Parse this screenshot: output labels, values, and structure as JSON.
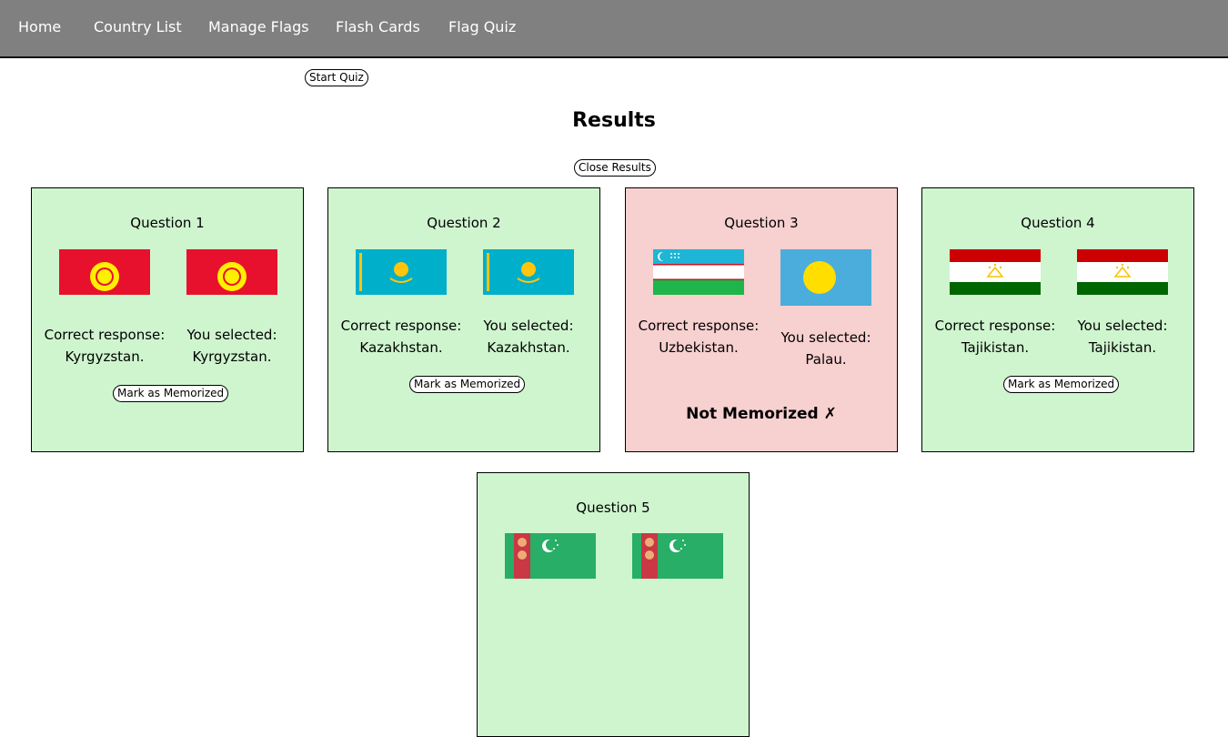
{
  "nav": {
    "items": [
      "Home",
      "Country List",
      "Manage Flags",
      "Flash Cards",
      "Flag Quiz"
    ]
  },
  "start_quiz_label": "Start Quiz",
  "results": {
    "title": "Results",
    "close_label": "Close Results",
    "mark_label": "Mark as Memorized",
    "not_memorized_label": "Not Memorized ✗",
    "correct_prefix": "Correct response:",
    "selected_prefix": "You selected:",
    "questions": [
      {
        "title": "Question 1",
        "correct": "Kyrgyzstan.",
        "selected": "Kyrgyzstan.",
        "is_correct": true
      },
      {
        "title": "Question 2",
        "correct": "Kazakhstan.",
        "selected": "Kazakhstan.",
        "is_correct": true
      },
      {
        "title": "Question 3",
        "correct": "Uzbekistan.",
        "selected": "Palau.",
        "is_correct": false
      },
      {
        "title": "Question 4",
        "correct": "Tajikistan.",
        "selected": "Tajikistan.",
        "is_correct": true
      },
      {
        "title": "Question 5"
      }
    ]
  },
  "colors": {
    "nav_bg": "#808080",
    "correct_bg": "#cff5cf",
    "wrong_bg": "#f7d0d0"
  }
}
